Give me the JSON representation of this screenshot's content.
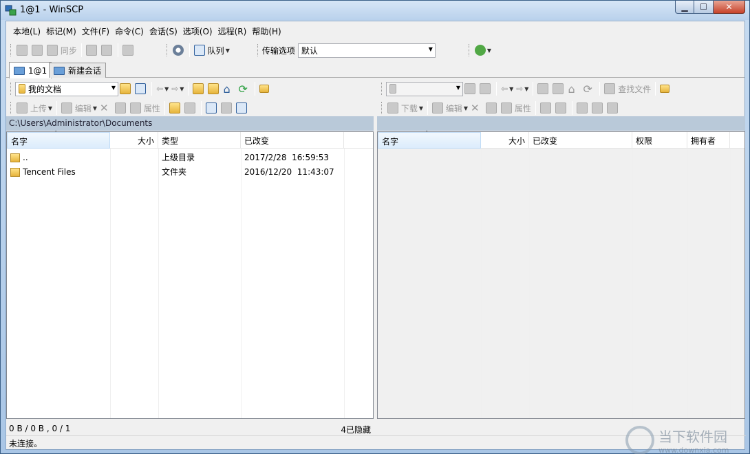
{
  "window": {
    "title": "1@1 - WinSCP",
    "min": "▁",
    "max": "☐",
    "close": "✕"
  },
  "menu": [
    "本地(L)",
    "标记(M)",
    "文件(F)",
    "命令(C)",
    "会话(S)",
    "选项(O)",
    "远程(R)",
    "帮助(H)"
  ],
  "toolbar": {
    "sync_label": "同步",
    "queue_label": "队列",
    "transfer_label": "传输选项",
    "transfer_value": "默认"
  },
  "tabs": [
    "1@1",
    "新建会话"
  ],
  "left": {
    "location": "我的文档",
    "path": "C:\\Users\\Administrator\\Documents",
    "upload": "上传",
    "edit": "编辑",
    "props": "属性",
    "columns": [
      "名字",
      "大小",
      "类型",
      "已改变"
    ],
    "rows": [
      {
        "name": "..",
        "size": "",
        "type": "上级目录",
        "changed": "2017/2/28  16:59:53"
      },
      {
        "name": "Tencent Files",
        "size": "",
        "type": "文件夹",
        "changed": "2016/12/20  11:43:07"
      }
    ],
    "status_left": "0 B / 0 B , 0 / 1",
    "status_right": "4已隐藏"
  },
  "right": {
    "download": "下载",
    "edit": "编辑",
    "props": "属性",
    "find": "查找文件",
    "columns": [
      "名字",
      "大小",
      "已改变",
      "权限",
      "拥有者"
    ]
  },
  "status": "未连接。",
  "watermark": {
    "line1": "当下软件园",
    "line2": "www.downxia.com"
  }
}
